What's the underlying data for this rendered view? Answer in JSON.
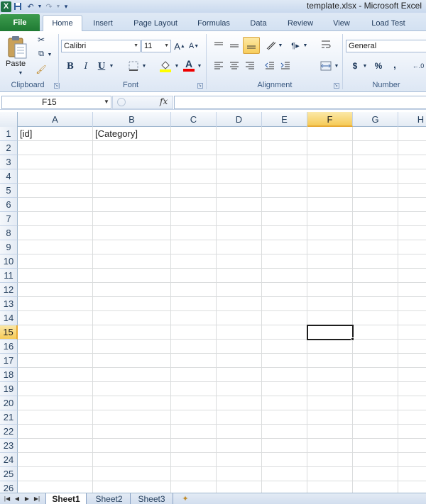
{
  "window": {
    "title": "template.xlsx - Microsoft Excel"
  },
  "qat": {
    "logo": "X",
    "undo": "↶",
    "redo": "↷"
  },
  "tabs": [
    {
      "label": "File"
    },
    {
      "label": "Home"
    },
    {
      "label": "Insert"
    },
    {
      "label": "Page Layout"
    },
    {
      "label": "Formulas"
    },
    {
      "label": "Data"
    },
    {
      "label": "Review"
    },
    {
      "label": "View"
    },
    {
      "label": "Load Test"
    }
  ],
  "ribbon": {
    "paste_label": "Paste",
    "font_name": "Calibri",
    "font_size": "11",
    "grow_font": "A",
    "shrink_font": "A",
    "bold": "B",
    "italic": "I",
    "underline": "U",
    "font_color_letter": "A",
    "number_format": "General",
    "currency": "$",
    "percent": "%",
    "comma": ",",
    "groups": {
      "clipboard": "Clipboard",
      "font": "Font",
      "alignment": "Alignment",
      "number": "Number"
    }
  },
  "formula_bar": {
    "name_box": "F15",
    "fx_label": "fx",
    "content": ""
  },
  "grid": {
    "columns": [
      "A",
      "B",
      "C",
      "D",
      "E",
      "F",
      "G",
      "H"
    ],
    "selected_column": "F",
    "rows": [
      "1",
      "2",
      "3",
      "4",
      "5",
      "6",
      "7",
      "8",
      "9",
      "10",
      "11",
      "12",
      "13",
      "14",
      "15",
      "16",
      "17",
      "18",
      "19",
      "20",
      "21",
      "22",
      "23",
      "24",
      "25",
      "26"
    ],
    "selected_row": "15",
    "cells": {
      "A1": "[id]",
      "B1": "[Category]"
    },
    "active_cell": "F15"
  },
  "sheets": [
    {
      "name": "Sheet1",
      "active": true
    },
    {
      "name": "Sheet2",
      "active": false
    },
    {
      "name": "Sheet3",
      "active": false
    }
  ],
  "colors": {
    "file_tab": "#1f7a33",
    "selection_header": "#f6cb58",
    "gridline": "#dadcdd"
  }
}
